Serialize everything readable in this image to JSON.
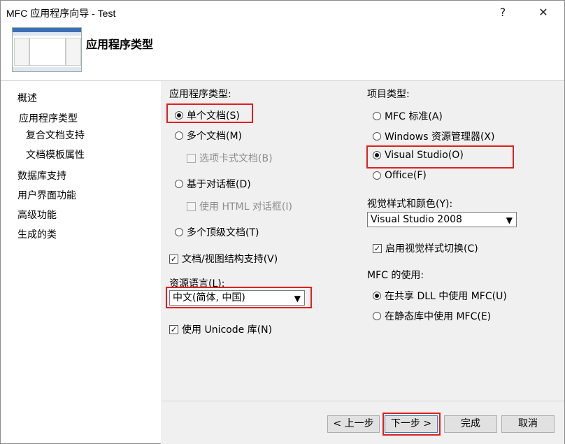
{
  "window": {
    "title": "MFC 应用程序向导 - Test",
    "help": "?",
    "close": "✕"
  },
  "header": {
    "title": "应用程序类型"
  },
  "sidebar": {
    "items": [
      "概述",
      "应用程序类型",
      "复合文档支持",
      "文档模板属性",
      "数据库支持",
      "用户界面功能",
      "高级功能",
      "生成的类"
    ]
  },
  "app_type": {
    "label": "应用程序类型:",
    "options": {
      "single_doc": "单个文档(S)",
      "multi_doc": "多个文档(M)",
      "tabbed_docs": "选项卡式文档(B)",
      "dialog_based": "基于对话框(D)",
      "use_html_dialog": "使用 HTML 对话框(I)",
      "multi_top_level": "多个顶级文档(T)"
    },
    "selected": "single_doc"
  },
  "docview_support": {
    "label": "文档/视图结构支持(V)",
    "checked": true
  },
  "resource_lang": {
    "label": "资源语言(L):",
    "value": "中文(简体, 中国)"
  },
  "unicode": {
    "label": "使用 Unicode 库(N)",
    "checked": true
  },
  "project_type": {
    "label": "项目类型:",
    "options": {
      "mfc_standard": "MFC 标准(A)",
      "windows_explorer": "Windows 资源管理器(X)",
      "visual_studio": "Visual Studio(O)",
      "office": "Office(F)"
    },
    "selected": "visual_studio"
  },
  "visual_style": {
    "label": "视觉样式和颜色(Y):",
    "value": "Visual Studio 2008"
  },
  "visual_switch": {
    "label": "启用视觉样式切换(C)",
    "checked": true
  },
  "mfc_use": {
    "label": "MFC 的使用:",
    "options": {
      "shared_dll": "在共享 DLL 中使用 MFC(U)",
      "static_lib": "在静态库中使用 MFC(E)"
    },
    "selected": "shared_dll"
  },
  "buttons": {
    "back": "< 上一步",
    "next": "下一步 >",
    "finish": "完成",
    "cancel": "取消"
  },
  "colors": {
    "highlight": "#e0201e",
    "accent": "#3d6fb5"
  }
}
